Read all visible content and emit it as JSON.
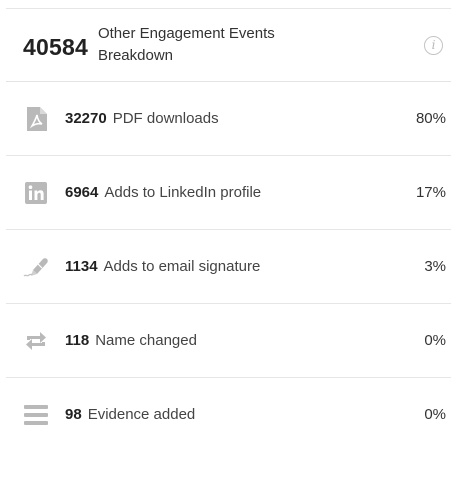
{
  "header": {
    "total": "40584",
    "title": "Other Engagement Events Breakdown",
    "info_glyph": "i"
  },
  "rows": [
    {
      "icon": "pdf-file-icon",
      "count": "32270",
      "label": "PDF downloads",
      "percent": "80%"
    },
    {
      "icon": "linkedin-icon",
      "count": "6964",
      "label": "Adds to LinkedIn profile",
      "percent": "17%"
    },
    {
      "icon": "pen-icon",
      "count": "1134",
      "label": "Adds to email signature",
      "percent": "3%"
    },
    {
      "icon": "swap-arrows-icon",
      "count": "118",
      "label": "Name changed",
      "percent": "0%"
    },
    {
      "icon": "list-lines-icon",
      "count": "98",
      "label": "Evidence added",
      "percent": "0%"
    }
  ],
  "colors": {
    "icon_gray": "#b9b9b9",
    "text_dark": "#222222",
    "divider": "#e6e6e6"
  }
}
